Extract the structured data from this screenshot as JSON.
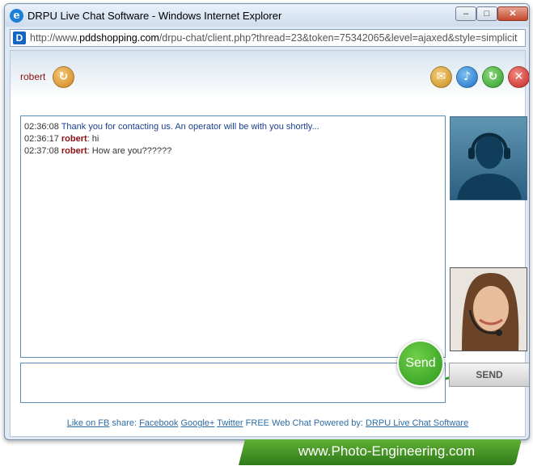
{
  "window": {
    "title": "DRPU Live Chat Software - Windows Internet Explorer",
    "minimize_label": "–",
    "maximize_label": "□",
    "close_label": "✕"
  },
  "address": {
    "url_prefix": "http://www.",
    "url_domain": "pddshopping.com",
    "url_rest": "/drpu-chat/client.php?thread=23&token=75342065&level=ajaxed&style=simplicit"
  },
  "header": {
    "user_name": "robert",
    "icons": [
      "refresh-user-icon",
      "mail-icon",
      "sound-icon",
      "refresh-icon",
      "close-icon"
    ],
    "colors": {
      "mail": "#c98a1b",
      "sound": "#1e6fc4",
      "refresh": "#2b9a26",
      "close": "#c62020"
    }
  },
  "chat": {
    "messages": [
      {
        "time": "02:36:08",
        "sender": "",
        "text": "Thank you for contacting us. An operator will be with you shortly..."
      },
      {
        "time": "02:36:17",
        "sender": "robert",
        "text": "hi"
      },
      {
        "time": "02:37:08",
        "sender": "robert",
        "text": "How are you??????"
      }
    ]
  },
  "composer": {
    "message_value": "",
    "send_label": "SEND",
    "callout_label": "Send"
  },
  "footer": {
    "like_link": "Like on FB",
    "share_text": "share:",
    "facebook_link": "Facebook",
    "googleplus_link": "Google+",
    "twitter_link": "Twitter",
    "powered_text": "FREE Web Chat Powered by:",
    "drpu_link": "DRPU Live Chat Software"
  },
  "watermark": {
    "text": "www.Photo-Engineering.com"
  }
}
